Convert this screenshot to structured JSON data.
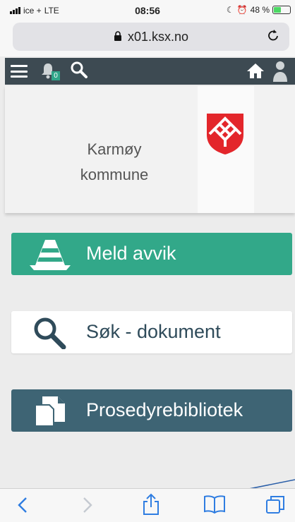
{
  "status": {
    "carrier": "ice +",
    "network": "LTE",
    "time": "08:56",
    "battery": "48 %",
    "battery_level": 0.48
  },
  "browser": {
    "url": "x01.ksx.no"
  },
  "topbar": {
    "notification_count": "0"
  },
  "org": {
    "name_line1": "Karmøy",
    "name_line2": "kommune"
  },
  "actions": [
    {
      "label": "Meld avvik"
    },
    {
      "label": "Søk - dokument"
    },
    {
      "label": "Prosedyrebibliotek"
    }
  ],
  "colors": {
    "topbar": "#3d4a52",
    "meld": "#32a889",
    "pros": "#3e6474",
    "accent_ios": "#2f7de1"
  }
}
